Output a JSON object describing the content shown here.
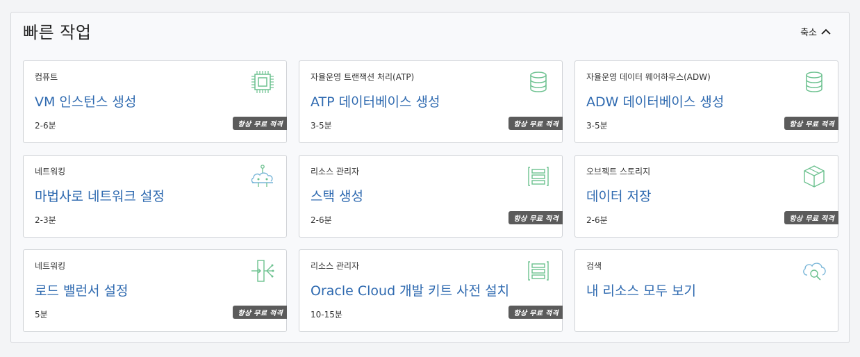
{
  "header": {
    "title": "빠른 작업",
    "collapse_label": "축소"
  },
  "colors": {
    "link": "#2f6ab0",
    "icon_green": "#6cc18f",
    "icon_blue": "#79b6d8",
    "badge_bg": "#5b5b5b"
  },
  "cards": [
    {
      "category": "컴퓨트",
      "action": "VM 인스턴스 생성",
      "time": "2-6분",
      "badge": "항상 무료 적격",
      "icon": "chip-icon"
    },
    {
      "category": "자율운영 트랜잭션 처리(ATP)",
      "action": "ATP 데이터베이스 생성",
      "time": "3-5분",
      "badge": "항상 무료 적격",
      "icon": "database-icon"
    },
    {
      "category": "자율운영 데이터 웨어하우스(ADW)",
      "action": "ADW 데이터베이스 생성",
      "time": "3-5분",
      "badge": "항상 무료 적격",
      "icon": "database-icon"
    },
    {
      "category": "네트워킹",
      "action": "마법사로 네트워크 설정",
      "time": "2-3분",
      "badge": "",
      "icon": "network-cloud-icon"
    },
    {
      "category": "리소스 관리자",
      "action": "스택 생성",
      "time": "2-6분",
      "badge": "항상 무료 적격",
      "icon": "stack-icon"
    },
    {
      "category": "오브젝트 스토리지",
      "action": "데이터 저장",
      "time": "2-6분",
      "badge": "항상 무료 적격",
      "icon": "box-icon"
    },
    {
      "category": "네트워킹",
      "action": "로드 밸런서 설정",
      "time": "5분",
      "badge": "항상 무료 적격",
      "icon": "load-balancer-icon"
    },
    {
      "category": "리소스 관리자",
      "action": "Oracle Cloud 개발 키트 사전 설치",
      "time": "10-15분",
      "badge": "항상 무료 적격",
      "icon": "stack-icon"
    },
    {
      "category": "검색",
      "action": "내 리소스 모두 보기",
      "time": "",
      "badge": "",
      "icon": "cloud-search-icon"
    }
  ]
}
